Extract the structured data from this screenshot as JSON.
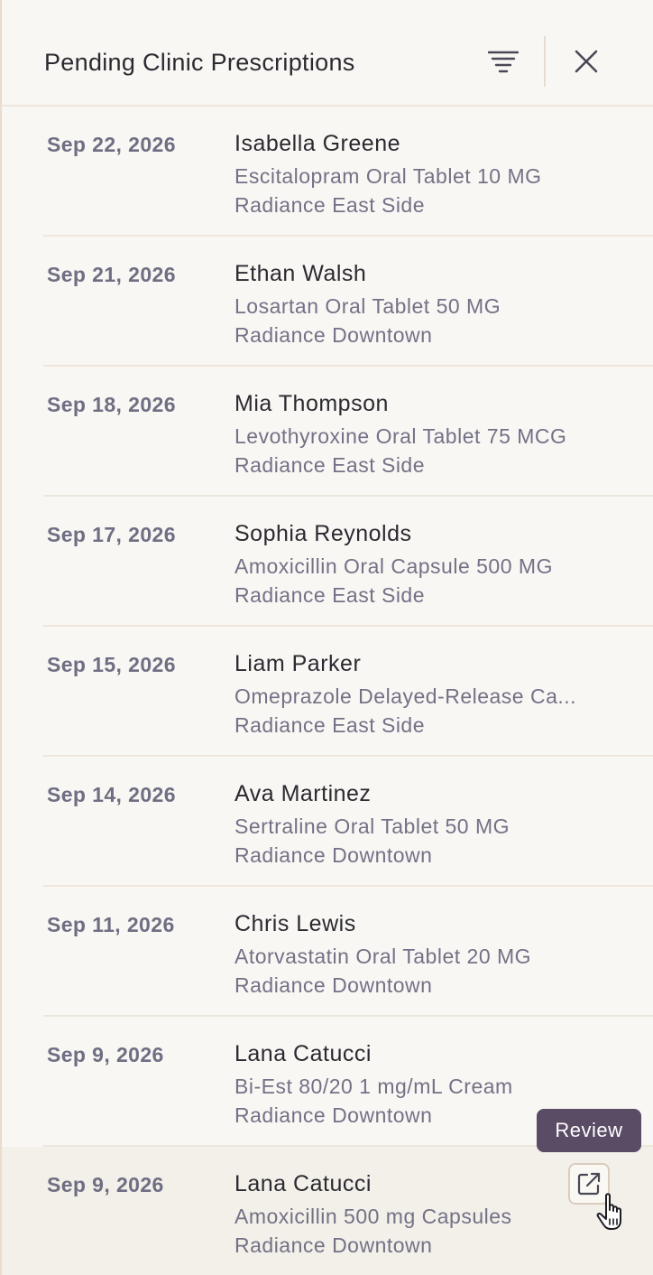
{
  "header": {
    "title": "Pending Clinic Prescriptions",
    "filter_icon": "filter-lines-icon",
    "close_icon": "close-x-icon"
  },
  "rows": [
    {
      "date": "Sep 22, 2026",
      "patient": "Isabella Greene",
      "medication": "Escitalopram Oral Tablet 10 MG",
      "location": "Radiance East Side"
    },
    {
      "date": "Sep 21, 2026",
      "patient": "Ethan Walsh",
      "medication": "Losartan Oral Tablet 50 MG",
      "location": "Radiance Downtown"
    },
    {
      "date": "Sep 18, 2026",
      "patient": "Mia Thompson",
      "medication": "Levothyroxine Oral Tablet 75 MCG",
      "location": "Radiance East Side"
    },
    {
      "date": "Sep 17, 2026",
      "patient": "Sophia Reynolds",
      "medication": "Amoxicillin Oral Capsule 500 MG",
      "location": "Radiance East Side"
    },
    {
      "date": "Sep 15, 2026",
      "patient": "Liam Parker",
      "medication": "Omeprazole Delayed-Release Ca...",
      "location": "Radiance East Side"
    },
    {
      "date": "Sep 14, 2026",
      "patient": "Ava Martinez",
      "medication": "Sertraline Oral Tablet 50 MG",
      "location": "Radiance Downtown"
    },
    {
      "date": "Sep 11, 2026",
      "patient": "Chris Lewis",
      "medication": "Atorvastatin Oral Tablet 20 MG",
      "location": "Radiance Downtown"
    },
    {
      "date": "Sep 9, 2026",
      "patient": "Lana Catucci",
      "medication": "Bi-Est 80/20 1 mg/mL Cream",
      "location": "Radiance Downtown"
    },
    {
      "date": "Sep 9, 2026",
      "patient": "Lana Catucci",
      "medication": "Amoxicillin 500 mg Capsules",
      "location": "Radiance Downtown"
    }
  ],
  "hovered_row_index": 8,
  "tooltip": {
    "label": "Review"
  },
  "icons": {
    "review": "external-link-icon",
    "cursor": "hand-pointer-icon"
  },
  "colors": {
    "background": "#f9f7f4",
    "text_primary": "#2b2a30",
    "text_secondary": "#747186",
    "tooltip_bg": "#5a4c65",
    "hover_row_bg": "#f3efe9",
    "divider": "#ede6dc"
  }
}
